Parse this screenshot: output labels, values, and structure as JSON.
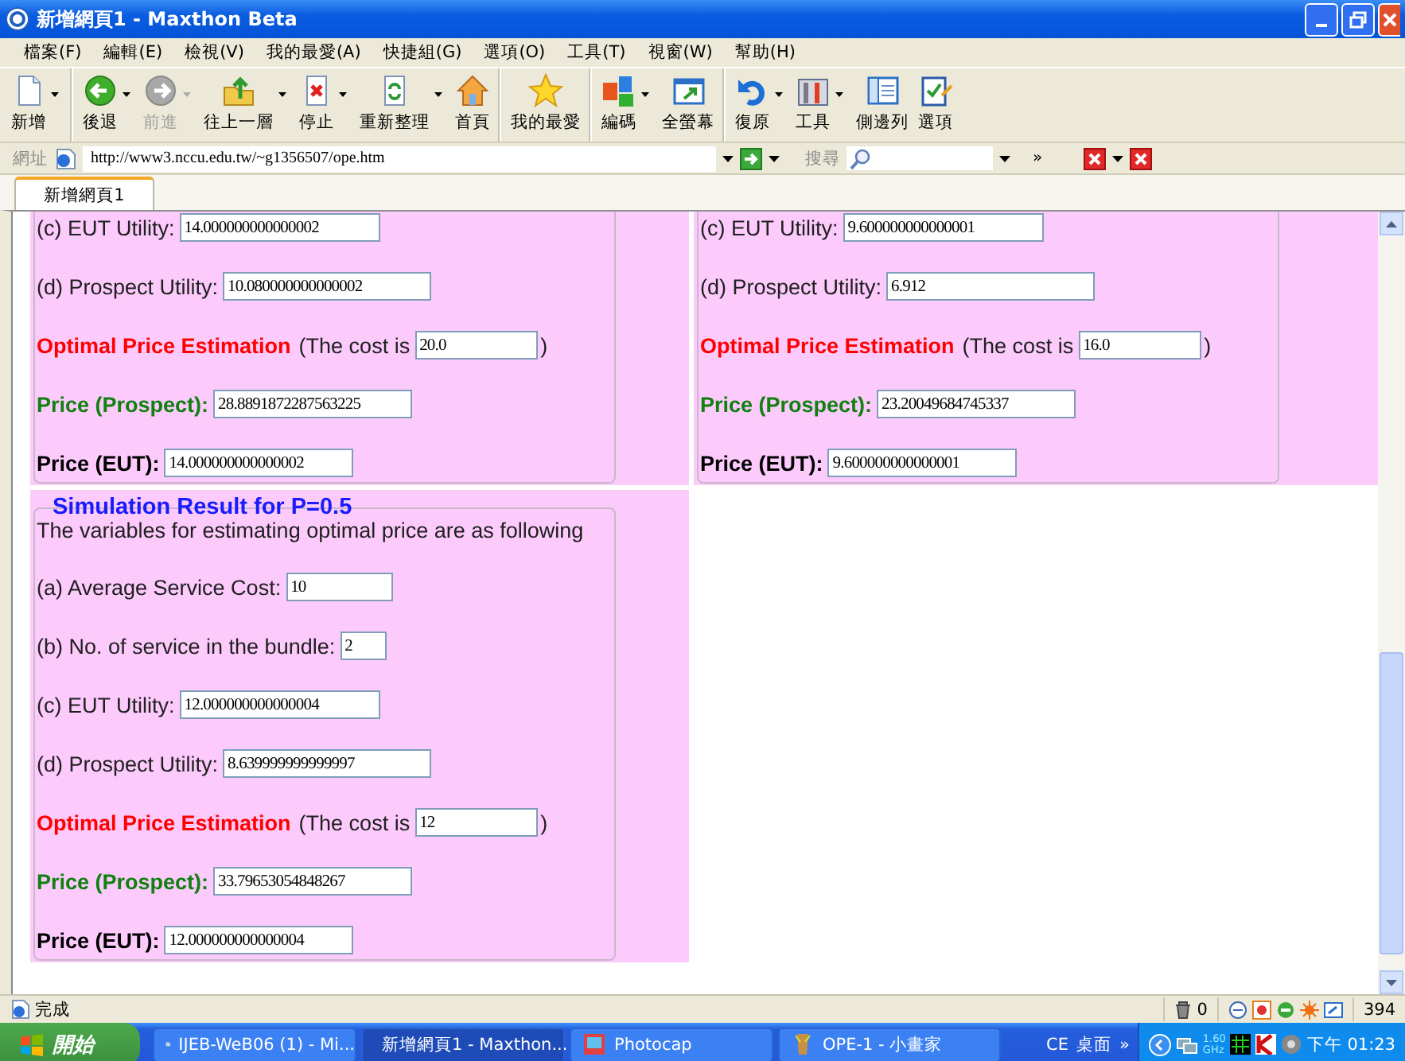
{
  "window": {
    "title": "新增網頁1 - Maxthon Beta"
  },
  "menu": [
    {
      "label": "檔案(F)"
    },
    {
      "label": "編輯(E)"
    },
    {
      "label": "檢視(V)"
    },
    {
      "label": "我的最愛(A)"
    },
    {
      "label": "快捷組(G)"
    },
    {
      "label": "選項(O)"
    },
    {
      "label": "工具(T)"
    },
    {
      "label": "視窗(W)"
    },
    {
      "label": "幫助(H)"
    }
  ],
  "toolbar": [
    {
      "label": "新增",
      "dropdown": true,
      "disabled": false,
      "separator_after": true
    },
    {
      "label": "後退",
      "dropdown": true,
      "disabled": false,
      "separator_after": false
    },
    {
      "label": "前進",
      "dropdown": true,
      "disabled": true,
      "separator_after": false
    },
    {
      "label": "往上一層",
      "dropdown": true,
      "disabled": false,
      "separator_after": false
    },
    {
      "label": "停止",
      "dropdown": true,
      "disabled": false,
      "separator_after": false
    },
    {
      "label": "重新整理",
      "dropdown": true,
      "disabled": false,
      "separator_after": false
    },
    {
      "label": "首頁",
      "dropdown": false,
      "disabled": false,
      "separator_after": true
    },
    {
      "label": "我的最愛",
      "dropdown": false,
      "disabled": false,
      "separator_after": true
    },
    {
      "label": "編碼",
      "dropdown": true,
      "disabled": false,
      "separator_after": false
    },
    {
      "label": "全螢幕",
      "dropdown": false,
      "disabled": false,
      "separator_after": true
    },
    {
      "label": "復原",
      "dropdown": true,
      "disabled": false,
      "separator_after": false
    },
    {
      "label": "工具",
      "dropdown": true,
      "disabled": false,
      "separator_after": false
    },
    {
      "label": "側邊列",
      "dropdown": false,
      "disabled": false,
      "separator_after": false
    },
    {
      "label": "選項",
      "dropdown": false,
      "disabled": false,
      "separator_after": false
    }
  ],
  "address_bar": {
    "label": "網址",
    "value": "http://www3.nccu.edu.tw/~g1356507/ope.htm"
  },
  "search": {
    "label": "搜尋",
    "more": "»"
  },
  "tabs": [
    {
      "label": "新增網頁1",
      "selected": true
    }
  ],
  "panels": [
    {
      "cut_top": true,
      "rows": [
        {
          "kind": "utility",
          "label": "(c) EUT Utility:",
          "value": "14.000000000000002"
        },
        {
          "kind": "prospect_utility",
          "label": "(d) Prospect Utility:",
          "value": "10.080000000000002"
        },
        {
          "kind": "estimate",
          "label": "Optimal Price Estimation",
          "note": "(The cost is",
          "value": "20.0",
          "close": ")"
        },
        {
          "kind": "price_prospect",
          "label": "Price (Prospect):",
          "value": "28.8891872287563225"
        },
        {
          "kind": "price_eut",
          "label": "Price (EUT):",
          "value": "14.000000000000002"
        }
      ]
    },
    {
      "cut_top": true,
      "rows": [
        {
          "kind": "utility",
          "label": "(c) EUT Utility:",
          "value": "9.600000000000001"
        },
        {
          "kind": "prospect_utility",
          "label": "(d) Prospect Utility:",
          "value": "6.912"
        },
        {
          "kind": "estimate",
          "label": "Optimal Price Estimation",
          "note": "(The cost is",
          "value": "16.0",
          "close": ")"
        },
        {
          "kind": "price_prospect",
          "label": "Price (Prospect):",
          "value": "23.20049684745337"
        },
        {
          "kind": "price_eut",
          "label": "Price (EUT):",
          "value": "9.600000000000001"
        }
      ]
    },
    {
      "cut_top": false,
      "title": "Simulation Result for P=0.5",
      "intro": "The variables for estimating optimal price are as following",
      "rows": [
        {
          "kind": "cost",
          "label": "(a) Average Service Cost:",
          "value": "10"
        },
        {
          "kind": "count",
          "label": "(b) No. of service in the bundle:",
          "value": "2"
        },
        {
          "kind": "utility",
          "label": "(c) EUT Utility:",
          "value": "12.000000000000004"
        },
        {
          "kind": "prospect_utility",
          "label": "(d) Prospect Utility:",
          "value": "8.639999999999997"
        },
        {
          "kind": "estimate",
          "label": "Optimal Price Estimation",
          "note": "(The cost is",
          "value": "12",
          "close": ")"
        },
        {
          "kind": "price_prospect",
          "label": "Price (Prospect):",
          "value": "33.79653054848267"
        },
        {
          "kind": "price_eut",
          "label": "Price (EUT):",
          "value": "12.000000000000004"
        }
      ]
    }
  ],
  "status_bar": {
    "text": "完成",
    "trash_count": "0",
    "memory": "394"
  },
  "taskbar": {
    "start": "開始",
    "tasks": [
      {
        "label": "IJEB-WeB06 (1) - Mi...",
        "selected": false
      },
      {
        "label": "新增網頁1 - Maxthon...",
        "selected": true
      },
      {
        "label": "Photocap",
        "selected": false
      },
      {
        "label": "OPE-1 - 小畫家",
        "selected": false
      }
    ],
    "tray": {
      "language": "CE",
      "desktop": "桌面",
      "more": "»",
      "cpu": "1.60",
      "cpu_unit": "GHz",
      "clock": "下午 01:23"
    }
  }
}
